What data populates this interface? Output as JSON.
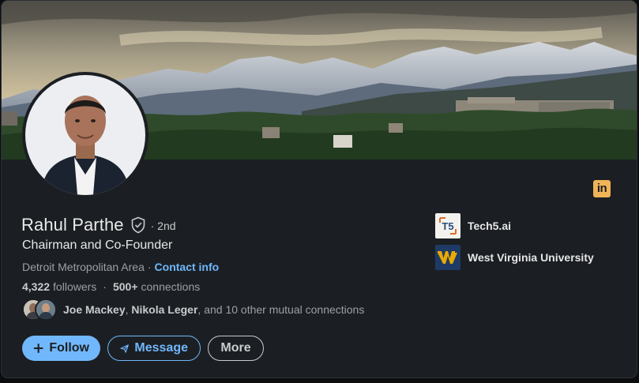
{
  "profile": {
    "name": "Rahul Parthe",
    "degree": "· 2nd",
    "headline": "Chairman and Co-Founder",
    "location": "Detroit Metropolitan Area",
    "location_sep": "·",
    "contact_info": "Contact info",
    "followers_count": "4,322",
    "followers_label": "followers",
    "stats_sep": "·",
    "connections_count": "500+",
    "connections_label": "connections"
  },
  "mutual": {
    "name1": "Joe Mackey",
    "sep": ",",
    "name2": "Nikola Leger",
    "rest": ", and 10 other mutual connections"
  },
  "actions": {
    "follow_label": "Follow",
    "message_label": "Message",
    "more_label": "More"
  },
  "organizations": [
    {
      "name": "Tech5.ai",
      "logo_text": "T5"
    },
    {
      "name": "West Virginia University",
      "logo_text": "WV"
    }
  ],
  "linkedin_badge": "in",
  "colors": {
    "card_bg": "#1b1f23",
    "accent": "#71b7fb",
    "linkedin_badge": "#f0b357",
    "wvu_gold": "#eaaa00",
    "wvu_blue": "#1f3a66"
  },
  "icons": {
    "verified": "shield-check-icon",
    "follow": "plus-icon",
    "message": "send-icon",
    "linkedin": "linkedin-icon"
  }
}
